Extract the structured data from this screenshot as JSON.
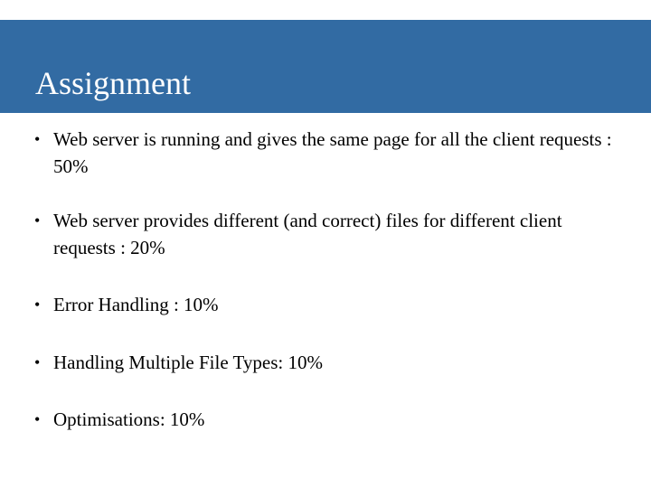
{
  "slide": {
    "title": "Assignment",
    "bullet_symbol": "•",
    "bullets": [
      {
        "text": "Web server is running and gives the same page for all the client requests : 50%"
      },
      {
        "text": "Web server provides different (and correct) files for different client requests : 20%"
      },
      {
        "text": "Error Handling : 10%"
      },
      {
        "text": "Handling Multiple File Types: 10%"
      },
      {
        "text": "Optimisations: 10%"
      }
    ]
  },
  "colors": {
    "title_bar": "#326ba3",
    "title_text": "#ffffff",
    "body_text": "#000000",
    "background": "#ffffff"
  }
}
